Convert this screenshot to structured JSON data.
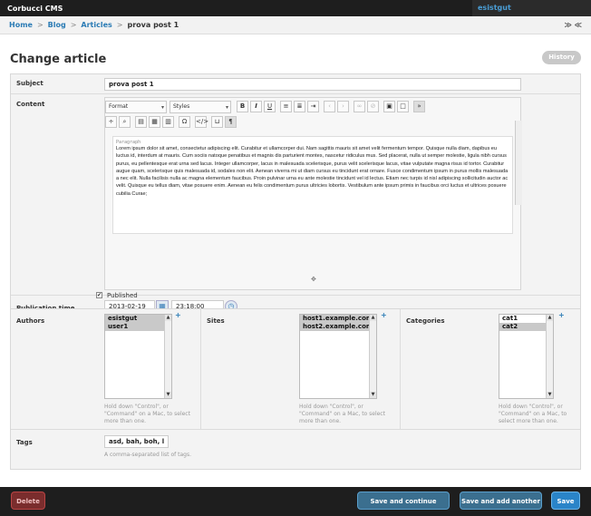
{
  "app": {
    "brand": "Corbucci CMS",
    "user": "esistgut"
  },
  "breadcrumb": {
    "home": "Home",
    "blog": "Blog",
    "articles": "Articles",
    "current": "prova post 1",
    "sep": ">",
    "tools": "≫ ≪"
  },
  "page": {
    "title": "Change article",
    "history_label": "History"
  },
  "form": {
    "subject": {
      "label": "Subject",
      "value": "prova post 1"
    },
    "content": {
      "label": "Content",
      "format_label": "Format",
      "styles_label": "Styles",
      "block_tag": "Paragraph",
      "block_tag_next": "Paragraph",
      "text": "Lorem ipsum dolor sit amet, consectetur adipiscing elit. Curabitur et ullamcorper dui. Nam sagittis mauris sit amet velit fermentum tempor. Quisque nulla diam, dapibus eu luctus id, interdum at mauris. Cum sociis natoque penatibus et magnis dis parturient montes, nascetur ridiculus mus. Sed placerat, nulla ut semper molestie, ligula nibh cursus purus, eu pellentesque erat urna sed lacus. Integer ullamcorper, lacus in malesuada scelerisque, purus velit scelerisque lacus, vitae vulputate magna risus id tortor. Curabitur augue quam, scelerisque quis malesuada id, sodales non elit. Aenean viverra mi ut diam cursus eu tincidunt erat ornare. Fusce condimentum ipsum in purus mollis malesuada a nec elit. Nulla facilisis nulla ac magna elementum faucibus. Proin pulvinar urna eu ante molestie tincidunt vel id lectus. Etiam nec turpis id nisl adipiscing sollicitudin auctor ac velit. Quisque eu tellus diam, vitae posuere enim. Aenean eu felis condimentum purus ultricies lobortis. Vestibulum ante ipsum primis in faucibus orci luctus et ultrices posuere cubilia Curae;"
    },
    "publication": {
      "label": "Publication time",
      "date": "2013-02-19",
      "time": "23:18:00"
    },
    "published": {
      "label": "Published",
      "checked": true
    },
    "authors": {
      "label": "Authors",
      "options": [
        "esistgut",
        "user1"
      ]
    },
    "sites": {
      "label": "Sites",
      "options": [
        "host1.example.com",
        "host2.example.com"
      ]
    },
    "categories": {
      "label": "Categories",
      "options": [
        "cat1",
        "cat2"
      ]
    },
    "multi_help": "Hold down \"Control\", or \"Command\" on a Mac, to select more than one.",
    "tags": {
      "label": "Tags",
      "value": "asd, bah, boh, lol, p",
      "help": "A comma-separated list of tags."
    }
  },
  "footer": {
    "delete": "Delete",
    "save_continue": "Save and continue editing",
    "save_add": "Save and add another",
    "save": "Save"
  }
}
